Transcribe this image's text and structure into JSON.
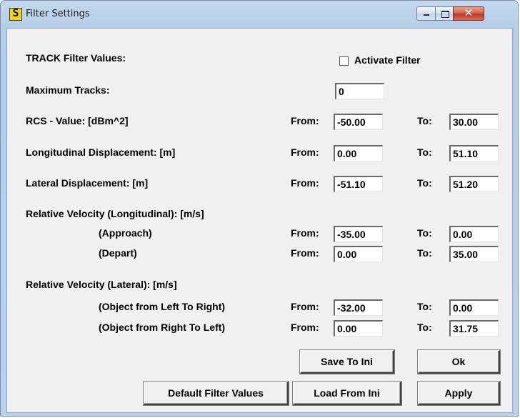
{
  "window": {
    "title": "Filter Settings",
    "icon_letter": "S"
  },
  "header": {
    "section_label": "TRACK Filter Values:",
    "activate_label": "Activate Filter",
    "activate_checked": false
  },
  "max_tracks": {
    "label": "Maximum Tracks:",
    "value": "0"
  },
  "common": {
    "from": "From:",
    "to": "To:"
  },
  "rcs": {
    "label": "RCS - Value: [dBm^2]",
    "from": "-50.00",
    "to": "30.00"
  },
  "long_disp": {
    "label": "Longitudinal Displacement: [m]",
    "from": "0.00",
    "to": "51.10"
  },
  "lat_disp": {
    "label": "Lateral Displacement: [m]",
    "from": "-51.10",
    "to": "51.20"
  },
  "rel_vel_long": {
    "label": "Relative Velocity (Longitudinal): [m/s]",
    "approach": {
      "label": "(Approach)",
      "from": "-35.00",
      "to": "0.00"
    },
    "depart": {
      "label": "(Depart)",
      "from": "0.00",
      "to": "35.00"
    }
  },
  "rel_vel_lat": {
    "label": "Relative Velocity (Lateral): [m/s]",
    "ltr": {
      "label": "(Object from Left To Right)",
      "from": "-32.00",
      "to": "0.00"
    },
    "rtl": {
      "label": "(Object from Right To Left)",
      "from": "0.00",
      "to": "31.75"
    }
  },
  "buttons": {
    "save": "Save To Ini",
    "ok": "Ok",
    "default": "Default Filter Values",
    "load": "Load From Ini",
    "apply": "Apply"
  }
}
